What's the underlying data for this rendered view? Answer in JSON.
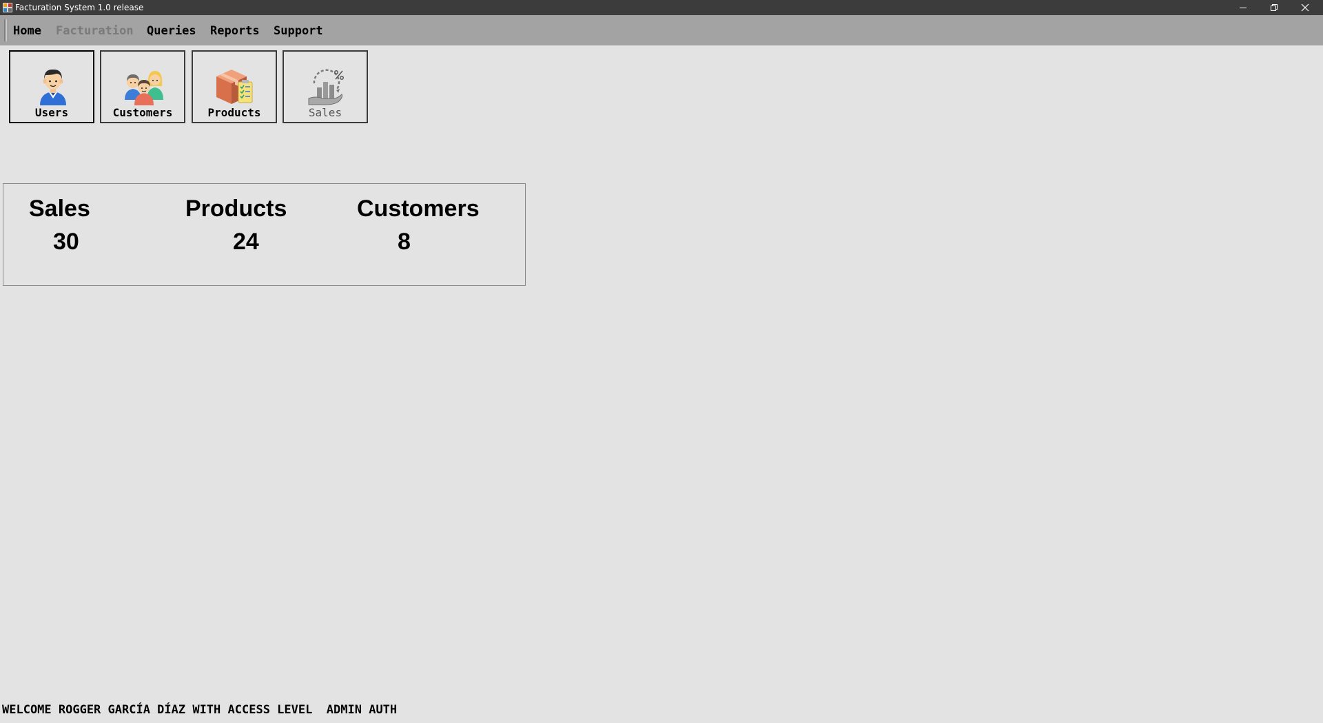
{
  "window": {
    "title": "Facturation System 1.0 release",
    "controls": {
      "minimize": "minimize-icon",
      "restore": "restore-icon",
      "close": "close-icon"
    }
  },
  "menu": {
    "items": [
      {
        "label": "Home",
        "enabled": true
      },
      {
        "label": "Facturation",
        "enabled": false
      },
      {
        "label": "Queries",
        "enabled": true
      },
      {
        "label": "Reports",
        "enabled": true
      },
      {
        "label": "Support",
        "enabled": true
      }
    ]
  },
  "toolbar": {
    "buttons": [
      {
        "label": "Users",
        "icon": "user-icon",
        "selected": true
      },
      {
        "label": "Customers",
        "icon": "customers-group-icon",
        "selected": false
      },
      {
        "label": "Products",
        "icon": "product-box-icon",
        "selected": false
      },
      {
        "label": "Sales",
        "icon": "sales-chart-icon",
        "selected": false,
        "dimmed": true
      }
    ]
  },
  "stats": {
    "sales": {
      "label": "Sales",
      "value": "30"
    },
    "products": {
      "label": "Products",
      "value": "24"
    },
    "customers": {
      "label": "Customers",
      "value": "8"
    }
  },
  "status": {
    "welcome_text": "WELCOME ROGGER GARCÍA DÍAZ WITH ACCESS LEVEL  ADMIN AUTH"
  },
  "colors": {
    "titlebar": "#3c3c3c",
    "menubar": "#a3a3a3",
    "background": "#e3e3e3",
    "disabled_text": "#7a7a7a"
  }
}
